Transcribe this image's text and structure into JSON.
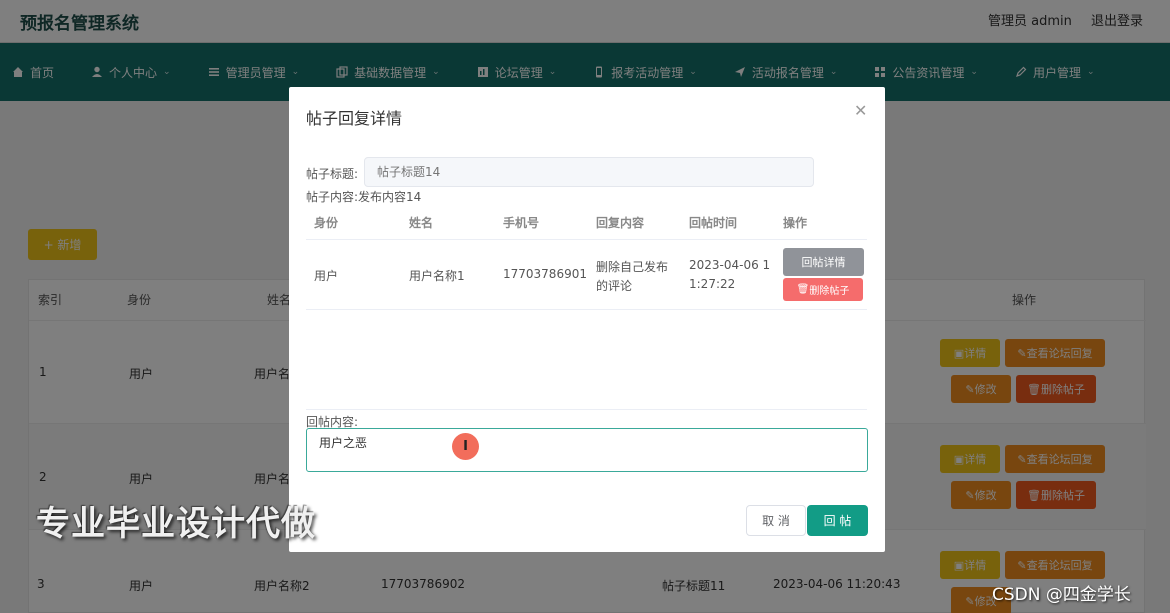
{
  "header": {
    "title": "预报名管理系统",
    "admin_label": "管理员 admin",
    "logout": "退出登录"
  },
  "nav": {
    "items": [
      {
        "label": "首页",
        "icon": "home-icon"
      },
      {
        "label": "个人中心",
        "icon": "user-icon"
      },
      {
        "label": "管理员管理",
        "icon": "list-icon"
      },
      {
        "label": "基础数据管理",
        "icon": "copy-icon"
      },
      {
        "label": "论坛管理",
        "icon": "chart-icon"
      },
      {
        "label": "报考活动管理",
        "icon": "phone-icon"
      },
      {
        "label": "活动报名管理",
        "icon": "send-icon"
      },
      {
        "label": "公告资讯管理",
        "icon": "grid-icon"
      },
      {
        "label": "用户管理",
        "icon": "edit-icon"
      }
    ]
  },
  "page": {
    "add_button": "+ 新增",
    "columns": [
      "索引",
      "身份",
      "姓名",
      "操作"
    ],
    "rows": [
      {
        "index": "1",
        "identity": "用户",
        "name": "用户名"
      },
      {
        "index": "2",
        "identity": "用户",
        "name": "用户名"
      },
      {
        "index": "3",
        "identity": "用户",
        "name": "用户名称2",
        "phone": "17703786902",
        "title": "帖子标题11",
        "time": "2023-04-06 11:20:43"
      }
    ],
    "ops": {
      "detail": "详情",
      "view_replies": "查看论坛回复",
      "edit": "修改",
      "delete": "删除帖子"
    }
  },
  "modal": {
    "title": "帖子回复详情",
    "post_title_label": "帖子标题:",
    "post_title_value": "帖子标题14",
    "post_content_label": "帖子内容:",
    "post_content_value": "发布内容14",
    "columns": [
      "身份",
      "姓名",
      "手机号",
      "回复内容",
      "回帖时间",
      "操作"
    ],
    "row": {
      "identity": "用户",
      "name": "用户名称1",
      "phone": "17703786901",
      "content_line1": "删除自己发布",
      "content_line2": "的评论",
      "time_line1": "2023-04-06 1",
      "time_line2": "1:27:22",
      "detail_button": "回帖详情",
      "delete_button": "删除帖子"
    },
    "reply_label": "回帖内容:",
    "reply_value": "用户之恶",
    "cancel": "取 消",
    "submit": "回 帖"
  },
  "watermarks": {
    "left": "专业毕业设计代做",
    "right": "CSDN @四金学长"
  }
}
